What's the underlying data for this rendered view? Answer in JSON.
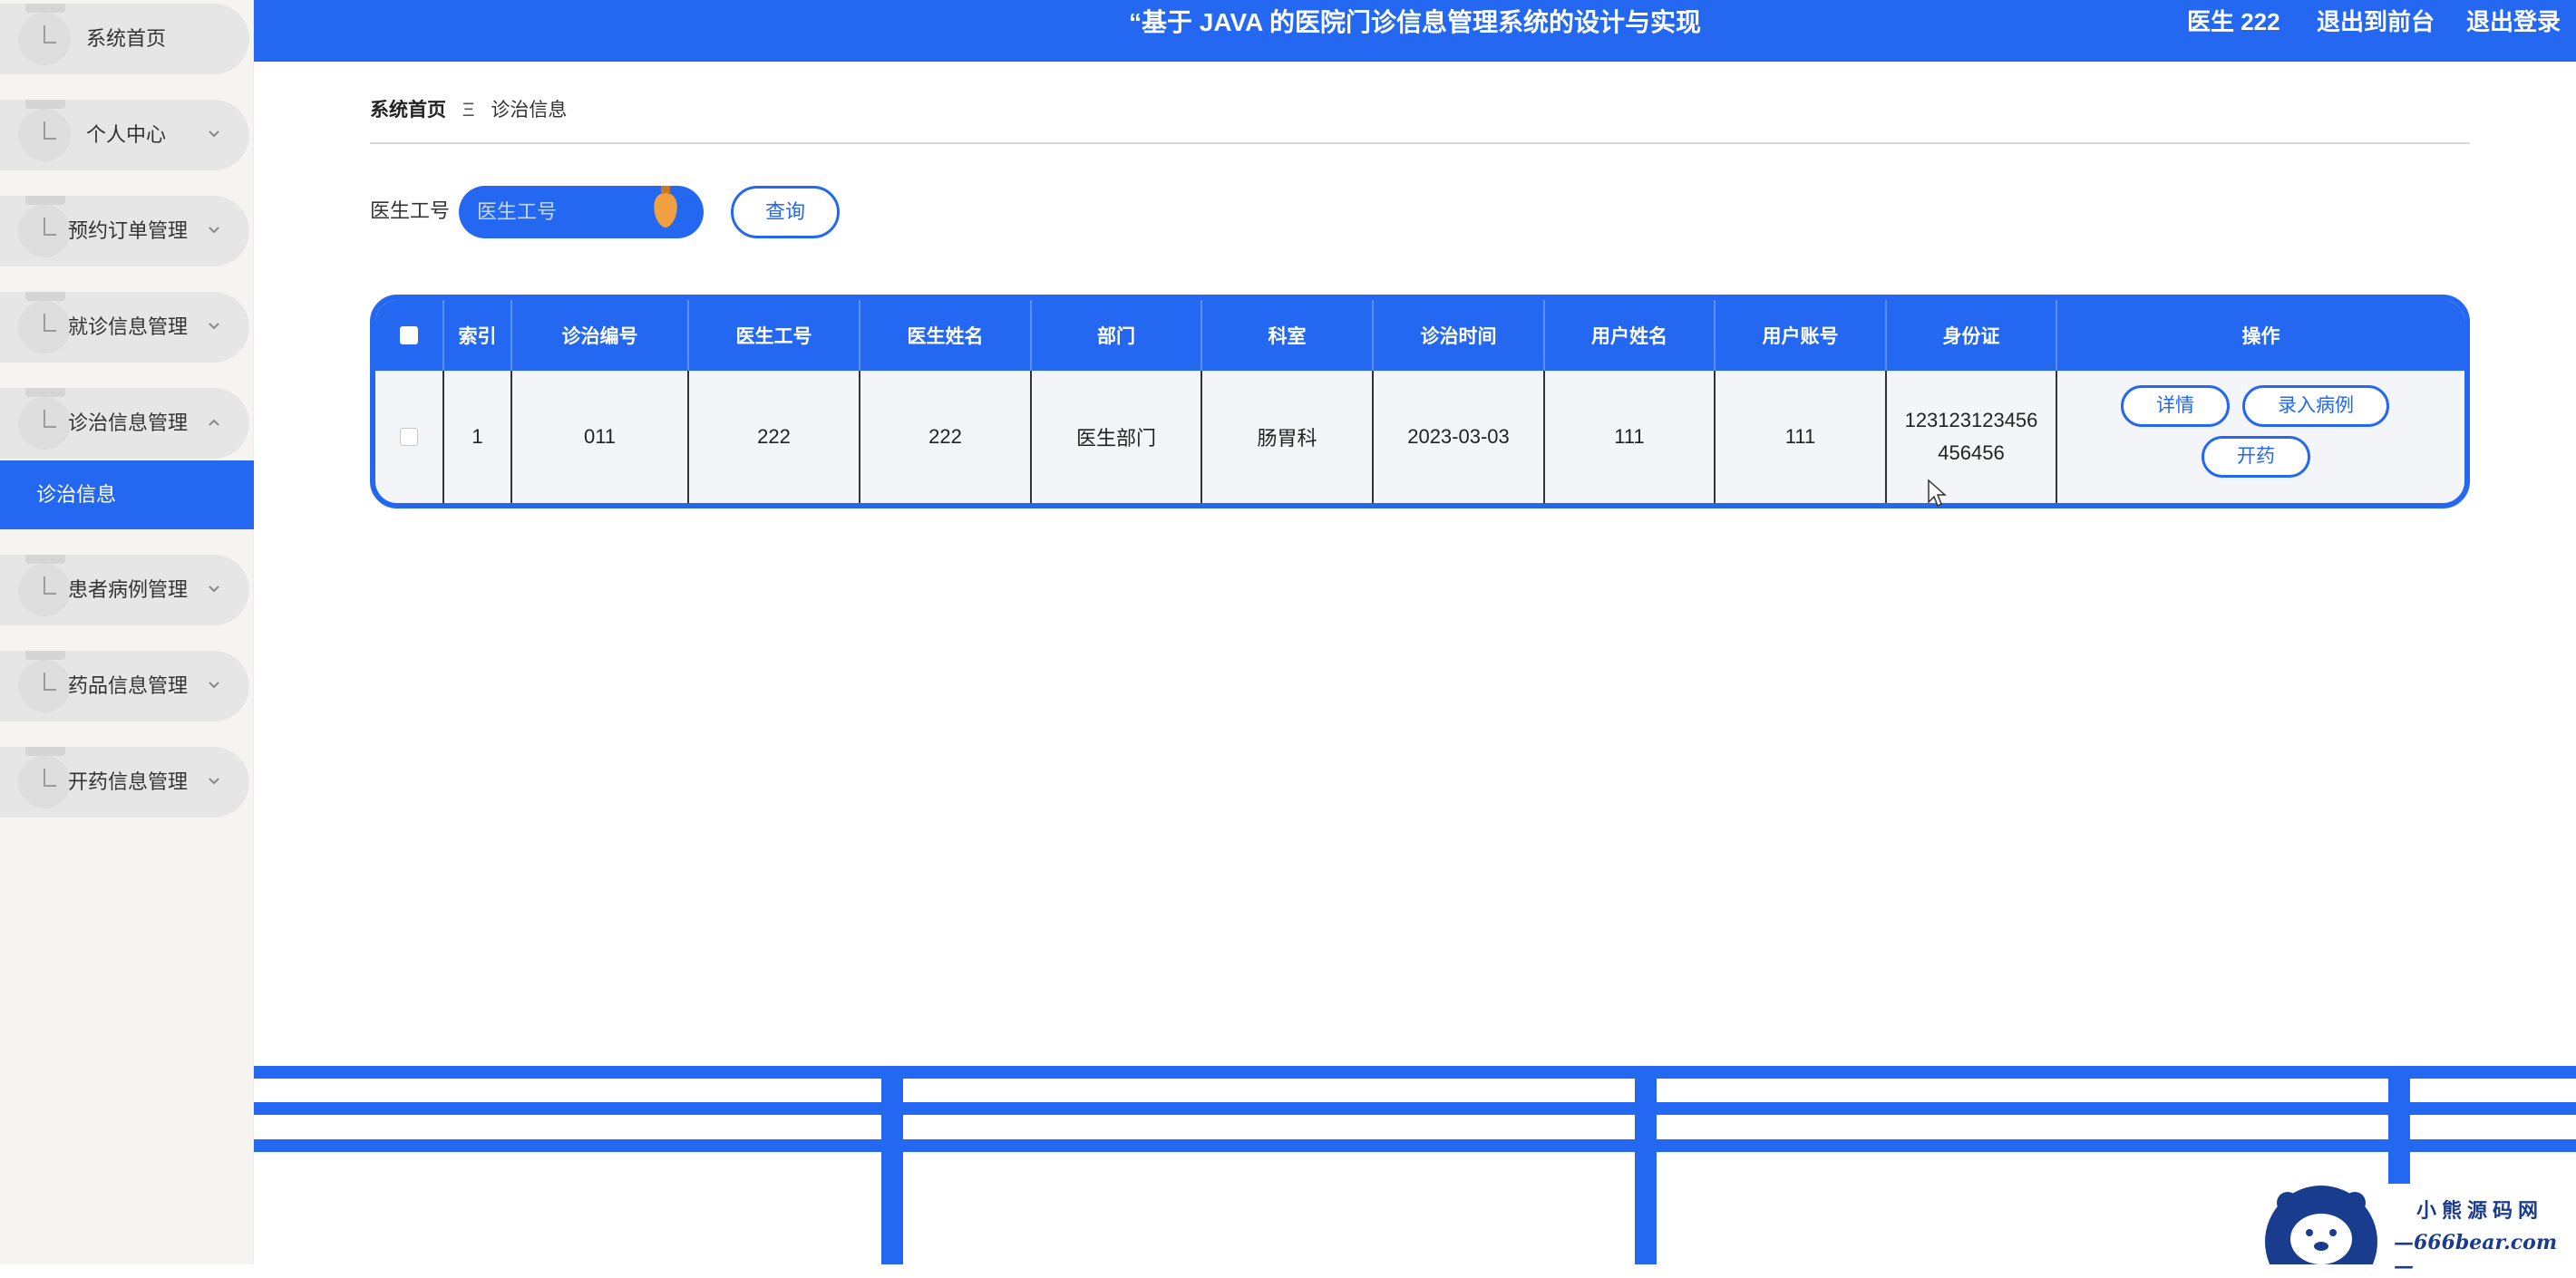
{
  "sidebar": {
    "items": [
      {
        "label": "系统首页",
        "has_chevron": false
      },
      {
        "label": "个人中心",
        "has_chevron": true
      },
      {
        "label": "预约订单管理",
        "has_chevron": true
      },
      {
        "label": "就诊信息管理",
        "has_chevron": true
      },
      {
        "label": "诊治信息管理",
        "has_chevron": true,
        "expanded": true
      },
      {
        "label": "患者病例管理",
        "has_chevron": true
      },
      {
        "label": "药品信息管理",
        "has_chevron": true
      },
      {
        "label": "开药信息管理",
        "has_chevron": true
      }
    ],
    "active_sub": "诊治信息"
  },
  "header": {
    "title": "“基于 JAVA 的医院门诊信息管理系统的设计与实现",
    "user": "医生 222",
    "to_front": "退出到前台",
    "logout": "退出登录"
  },
  "breadcrumb": {
    "home": "系统首页",
    "separator": "Ξ",
    "current": "诊治信息"
  },
  "search": {
    "label": "医生工号",
    "placeholder": "医生工号",
    "value": "",
    "button": "查询"
  },
  "table": {
    "columns": [
      "索引",
      "诊治编号",
      "医生工号",
      "医生姓名",
      "部门",
      "科室",
      "诊治时间",
      "用户姓名",
      "用户账号",
      "身份证",
      "操作"
    ],
    "rows": [
      {
        "index": "1",
        "treat_no": "011",
        "doctor_no": "222",
        "doctor_name": "222",
        "department": "医生部门",
        "section": "肠胃科",
        "time": "2023-03-03",
        "user_name": "111",
        "user_account": "111",
        "id_line1": "123123123456",
        "id_line2": "456456",
        "actions": {
          "detail": "详情",
          "record": "录入病例",
          "prescribe": "开药"
        }
      }
    ]
  },
  "watermark": {
    "line1": "小熊源码网",
    "line2": "—666bear.com—"
  },
  "colors": {
    "primary": "#2468f2",
    "sidebar_bg": "#f5f4f0",
    "menu_bg": "#e6e6e6",
    "accent_pin": "#f0a040"
  },
  "icons": {
    "chevron": "chevron-down-icon",
    "chevron_up": "chevron-up-icon",
    "pin": "pin-icon",
    "cursor": "mouse-cursor-icon"
  }
}
